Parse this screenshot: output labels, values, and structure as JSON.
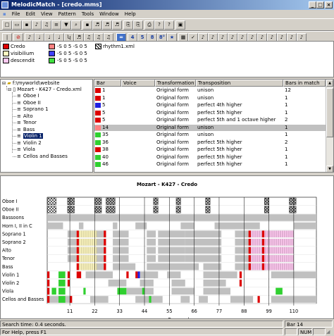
{
  "window": {
    "title": "MelodicMatch - [credo.mms]"
  },
  "menu": [
    "File",
    "Edit",
    "View",
    "Pattern",
    "Tools",
    "Window",
    "Help"
  ],
  "toolbar2": {
    "num_buttons": [
      "4",
      "5",
      "8",
      "8°"
    ]
  },
  "legend": {
    "groups": [
      {
        "label": "Credo",
        "color": "#dd0000"
      },
      {
        "label": "visibilium",
        "color": "#fff8c0"
      },
      {
        "label": "descendit",
        "color": "#ffc8f0"
      }
    ],
    "intervals": [
      {
        "label": "-S 0 5 -S 0 5",
        "color": "#ff8080"
      },
      {
        "label": "-S 0 5 -S 0 5",
        "color": "#4040ff"
      },
      {
        "label": "-S 0 5 -S 0 5",
        "color": "#40e040"
      }
    ],
    "file": "rhythm1.xml"
  },
  "tree": {
    "root": "f:\\myworld\\website",
    "piece": "Mozart - K427 - Credo.xml",
    "voices": [
      "Oboe I",
      "Oboe II",
      "Soprano 1",
      "Alto",
      "Tenor",
      "Bass",
      "Violin 1",
      "Violin 2",
      "Viola",
      "Cellos and Basses"
    ],
    "selected": "Violin 1"
  },
  "table": {
    "columns": [
      "Bar",
      "Voice",
      "Transformation",
      "Transposition",
      "Bars in match"
    ],
    "rows": [
      {
        "color": "#dd0000",
        "bar": "1",
        "voice": "",
        "transformation": "Original form",
        "transposition": "unison",
        "bars": "12"
      },
      {
        "color": "#dd0000",
        "bar": "1",
        "voice": "",
        "transformation": "Original form",
        "transposition": "unison",
        "bars": "1"
      },
      {
        "color": "#2020e0",
        "bar": "5",
        "voice": "",
        "transformation": "Original form",
        "transposition": "perfect 4th  higher",
        "bars": "1"
      },
      {
        "color": "#dd0000",
        "bar": "5",
        "voice": "",
        "transformation": "Original form",
        "transposition": "perfect 5th  higher",
        "bars": "1"
      },
      {
        "color": "#dd0000",
        "bar": "5",
        "voice": "",
        "transformation": "Original form",
        "transposition": "perfect 5th and 1 octave higher",
        "bars": "2"
      },
      {
        "color": "#ff8080",
        "bar": "14",
        "voice": "",
        "transformation": "Original form",
        "transposition": "unison",
        "bars": "1"
      },
      {
        "color": "#30d030",
        "bar": "35",
        "voice": "",
        "transformation": "Original form",
        "transposition": "unison",
        "bars": "1"
      },
      {
        "color": "#30d030",
        "bar": "36",
        "voice": "",
        "transformation": "Original form",
        "transposition": "perfect 5th  higher",
        "bars": "2"
      },
      {
        "color": "#dd0000",
        "bar": "38",
        "voice": "",
        "transformation": "Original form",
        "transposition": "perfect 5th  higher",
        "bars": "1"
      },
      {
        "color": "#30d030",
        "bar": "40",
        "voice": "",
        "transformation": "Original form",
        "transposition": "perfect 5th  higher",
        "bars": "1"
      },
      {
        "color": "#30d030",
        "bar": "46",
        "voice": "",
        "transformation": "Original form",
        "transposition": "perfect 5th  higher",
        "bars": "1"
      }
    ],
    "selected_row": 5
  },
  "chart": {
    "title": "Mozart - K427 - Credo",
    "xlabel": "Bar number",
    "voices": [
      "Oboe I",
      "Oboe II",
      "Bassoons",
      "Horn I, II in C",
      "Soprano 1",
      "Soprano 2",
      "Alto",
      "Tenor",
      "Bass",
      "Violin 1",
      "Violin 2",
      "Viola",
      "Cellos and Basses"
    ],
    "ticks": [
      "11",
      "22",
      "33",
      "44",
      "55",
      "66",
      "77",
      "88",
      "99",
      "110"
    ],
    "bar_range": [
      1,
      120
    ]
  },
  "status": {
    "search_time": "Search time: 0.4 seconds.",
    "bar": "Bar 14",
    "help": "For Help, press F1",
    "num": "NUM"
  }
}
